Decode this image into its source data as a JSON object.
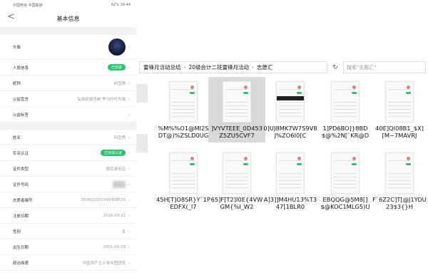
{
  "phone": {
    "status_left": "中国电信 中国联通",
    "status_right": "62% 18:44",
    "back_label": "<",
    "title": "基本信息",
    "rows": [
      {
        "label": "头像",
        "value": "",
        "kind": "avatar"
      },
      {
        "label": "人脸信息",
        "value": "已完善",
        "kind": "badge"
      },
      {
        "label": "昵称",
        "value": "何宜秀",
        "kind": "text"
      },
      {
        "label": "公益宣言",
        "value": "弘扬民族传统 争当时代先锋",
        "kind": "text"
      },
      {
        "label": "公益标签",
        "value": "",
        "kind": "text"
      },
      {
        "label": "姓名",
        "value": "何宜秀",
        "kind": "text"
      },
      {
        "label": "实名认证",
        "value": "已完成认证",
        "kind": "badge"
      },
      {
        "label": "证件类型",
        "value": "居民身份证",
        "kind": "text"
      },
      {
        "label": "证件号码",
        "value": "",
        "kind": "blur"
      },
      {
        "label": "志愿者编号",
        "value": "35062200104930853S",
        "kind": "text"
      },
      {
        "label": "注册日期",
        "value": "2018-03-22",
        "kind": "text"
      },
      {
        "label": "性别",
        "value": "女",
        "kind": "text"
      },
      {
        "label": "出生日期",
        "value": "2001-06-29",
        "kind": "text"
      },
      {
        "label": "政治面貌",
        "value": "中国共产主义青年团团员",
        "kind": "text"
      },
      {
        "label": "学历",
        "value": "",
        "kind": "text"
      }
    ]
  },
  "explorer": {
    "breadcrumb": [
      "雷锋月活动总结",
      "20级会计二班雷锋月活动",
      "志愿汇"
    ],
    "refresh_icon": "↻",
    "search_placeholder": "搜索\"志愿汇\"",
    "files": [
      {
        "name": "%M%%O1@MI2SDT@)%ZSLD0UG",
        "selected": false,
        "dark": false
      },
      {
        "name": "]VYVTEEE_0D453Z5ZU5CVF7",
        "selected": true,
        "dark": false
      },
      {
        "name": "0]UJ8MK7W7S9V8J%ZO6I0[C",
        "selected": false,
        "dark": true
      },
      {
        "name": "1]PD6BO]}8BD$@%2N[`KR@D",
        "selected": false,
        "dark": false
      },
      {
        "name": "40E]QI08B1_$X][M~7MAVRJ",
        "selected": false,
        "dark": false
      },
      {
        "name": "45H[T]O8SR}Y`1PEDFX(_I7",
        "selected": false,
        "dark": false
      },
      {
        "name": "65]F[T2]I0E{4VWGM{%I_W2",
        "selected": false,
        "dark": false
      },
      {
        "name": "A]3]]M4HU13%T347[1BLR0",
        "selected": false,
        "dark": false
      },
      {
        "name": "EBQQG@5M8[]$@KOC1MLG5)U",
        "selected": false,
        "dark": false
      },
      {
        "name": "F`6Z2C]T[@J1YOU23$3{}H",
        "selected": false,
        "dark": false
      }
    ]
  }
}
